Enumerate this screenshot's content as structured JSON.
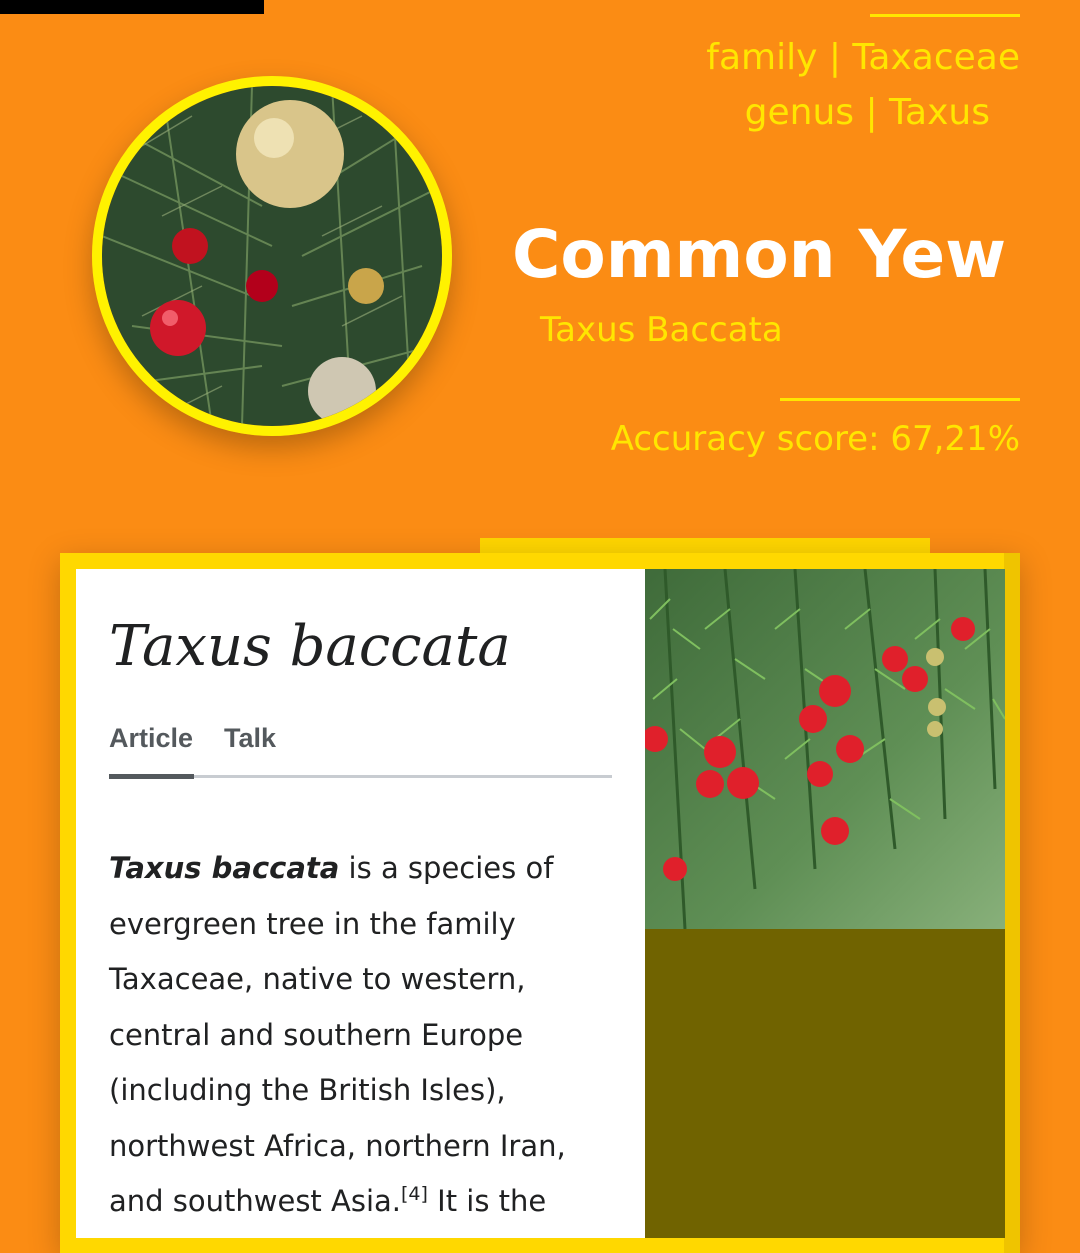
{
  "header": {
    "family": "family | Taxaceae",
    "genus": "genus | Taxus",
    "common_name": "Common Yew",
    "scientific_name": "Taxus Baccata",
    "accuracy": "Accuracy score: 67,21%"
  },
  "wiki": {
    "title": "Taxus baccata",
    "tabs": [
      "Article",
      "Talk"
    ],
    "active_tab": "Article",
    "body_lead": "Taxus baccata",
    "body_text": " is a species of evergreen tree in the family Taxaceae, native to western, central and southern Europe (including the British Isles), northwest Africa, northern Iran, and southwest Asia.",
    "citation": "[4]",
    "body_tail": " It is the"
  },
  "colors": {
    "background": "#FB8C14",
    "accent_yellow": "#FFE600",
    "frame_yellow": "#FFD800",
    "olive": "#706300"
  },
  "images": {
    "avatar": "christmas-tree-ornaments-photo",
    "wiki_photo": "yew-branch-red-berries-photo"
  }
}
